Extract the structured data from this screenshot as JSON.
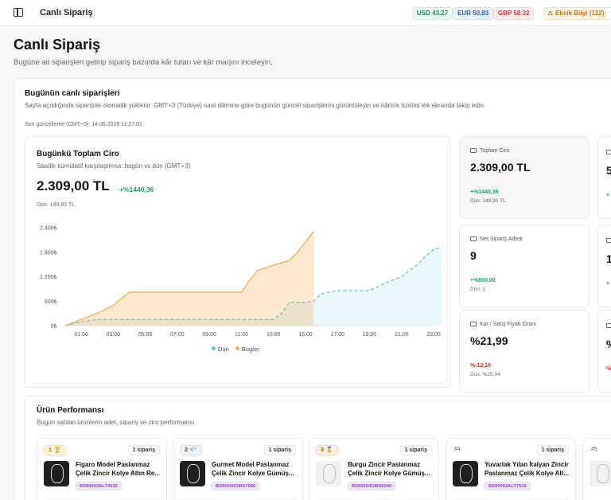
{
  "topbar": {
    "title": "Canlı Sipariş",
    "rates": [
      {
        "label": "USD 43.27",
        "color": "#13915a"
      },
      {
        "label": "EUR 50.83",
        "color": "#2463c7"
      },
      {
        "label": "GBP 58.32",
        "color": "#d23434"
      }
    ],
    "warning": "Eksik Bilgi (122)"
  },
  "page": {
    "title": "Canlı Sipariş",
    "subtitle": "Bugüne ait siparişleri getirip sipariş bazında kâr tutarı ve kâr marjını inceleyin."
  },
  "live": {
    "title": "Bugünün canlı siparişleri",
    "description": "Sayfa açıldığında siparişler otomatik yüklenir. GMT+3 (Türkiye) saat dilimine göre bugünün güncel siparişlerini görüntüleyin ve kârlılık özetini tek ekranda takip edin.",
    "last_updated": "Son güncelleme (GMT+3): 14.06.2026 11:27:01"
  },
  "revenue": {
    "title": "Bugünkü Toplam Ciro",
    "subtitle": "Saatlik kümülatif karşılaştırma: bugün vs dün (GMT+3)",
    "total": "2.309,00 TL",
    "delta": "+%1440,36",
    "yesterday": "Dün: 149,90 TL"
  },
  "kpis": [
    {
      "label": "Toplam Ciro",
      "value": "2.309,00 TL",
      "delta": "+%1440,36",
      "sub": "Dün: 149,90 TL",
      "trend": "up"
    },
    {
      "label": "Net Sipariş Adedi",
      "value": "9",
      "delta": "+%800,00",
      "sub": "Dün: 1",
      "trend": "up"
    },
    {
      "label": "Kar / Satış Fiyatı Oranı",
      "value": "%21,99",
      "delta": "%-12,18",
      "sub": "Dün: %25,04",
      "trend": "down"
    }
  ],
  "kpi_edge": [
    {
      "value": "5",
      "delta": "+"
    },
    {
      "value": "1",
      "delta": "+"
    },
    {
      "value": "%",
      "delta": "%"
    }
  ],
  "performance": {
    "title": "Ürün Performansı",
    "subtitle": "Bugün satılan ürünlerin adet, sipariş ve ciro performansı",
    "products": [
      {
        "rank": "1",
        "orders": "1 sipariş",
        "name": "Figaro Model Paslanmaz Çelik Zincir Kolye Altın Re...",
        "sku": "BS90003ALT4530"
      },
      {
        "rank": "2",
        "orders": "1 sipariş",
        "name": "Gurmet Model Paslanmaz Çelik Zincir Kolye Gümüş...",
        "sku": "BS90005GMS7060"
      },
      {
        "rank": "3",
        "orders": "1 sipariş",
        "name": "Burgu Zincir Paslanmaz Çelik Zincir Kolye Gümüş...",
        "sku": "BS90004GMS6040"
      },
      {
        "rank": "#4",
        "orders": "1 sipariş",
        "name": "Yuvarlak Yılan İtalyan Zincir Paslanmaz Çelik Kolye Alt...",
        "sku": "BS90002ALT7510"
      },
      {
        "rank": "#5",
        "orders": "",
        "name": "",
        "sku": ""
      }
    ]
  },
  "chart_data": {
    "type": "area",
    "title": "Bugünkü Toplam Ciro",
    "xlabel": "",
    "ylabel": "",
    "x_ticks": [
      "01:00",
      "03:00",
      "05:00",
      "07:00",
      "09:00",
      "11:00",
      "13:00",
      "15:00",
      "17:00",
      "19:00",
      "21:00",
      "23:00"
    ],
    "y_ticks": [
      "0₺",
      "600₺",
      "1.200₺",
      "1.800₺",
      "2.400₺"
    ],
    "ylim": [
      0,
      2400
    ],
    "xlim": [
      0,
      23
    ],
    "legend_position": "bottom",
    "series": [
      {
        "name": "Dün",
        "color": "#5bc1dd",
        "style": "dashed",
        "points": [
          [
            0,
            0
          ],
          [
            1,
            100
          ],
          [
            2,
            150
          ],
          [
            3,
            150
          ],
          [
            4,
            150
          ],
          [
            5,
            150
          ],
          [
            6,
            150
          ],
          [
            7,
            150
          ],
          [
            8,
            150
          ],
          [
            9,
            150
          ],
          [
            10,
            150
          ],
          [
            11,
            150
          ],
          [
            12,
            150
          ],
          [
            13,
            150
          ],
          [
            13.5,
            300
          ],
          [
            14,
            570
          ],
          [
            15,
            570
          ],
          [
            15.5,
            600
          ],
          [
            16,
            780
          ],
          [
            17,
            860
          ],
          [
            18,
            860
          ],
          [
            19,
            860
          ],
          [
            19.5,
            950
          ],
          [
            20,
            1050
          ],
          [
            21,
            1200
          ],
          [
            22,
            1500
          ],
          [
            22.5,
            1700
          ],
          [
            23,
            1870
          ],
          [
            23.5,
            1920
          ]
        ]
      },
      {
        "name": "Bugün",
        "color": "#f0ad4e",
        "style": "solid",
        "points": [
          [
            0,
            0
          ],
          [
            1,
            150
          ],
          [
            2,
            300
          ],
          [
            3,
            500
          ],
          [
            4,
            820
          ],
          [
            5,
            820
          ],
          [
            6,
            820
          ],
          [
            7,
            820
          ],
          [
            8,
            820
          ],
          [
            9,
            820
          ],
          [
            10,
            820
          ],
          [
            11,
            820
          ],
          [
            11.5,
            1100
          ],
          [
            12,
            1350
          ],
          [
            13,
            1480
          ],
          [
            14,
            1600
          ],
          [
            14.5,
            1800
          ],
          [
            15,
            2050
          ],
          [
            15.5,
            2309
          ]
        ]
      }
    ]
  }
}
